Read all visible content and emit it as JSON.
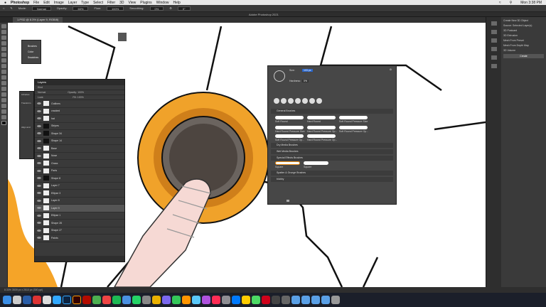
{
  "menubar": {
    "apple": "",
    "app": "Photoshop",
    "items": [
      "File",
      "Edit",
      "Image",
      "Layer",
      "Type",
      "Select",
      "Filter",
      "3D",
      "View",
      "Plugins",
      "Window",
      "Help"
    ],
    "clock": "Mon 3:38 PM"
  },
  "options": {
    "mode_label": "Mode:",
    "mode_value": "Normal",
    "opacity_label": "Opacity:",
    "opacity_value": "60%",
    "flow_label": "Flow:",
    "flow_value": "100%",
    "smoothing_label": "Smoothing:",
    "smoothing_value": "0%",
    "angle_value": "0°"
  },
  "window": {
    "title": "Adobe Photoshop 2021"
  },
  "tab": {
    "label": "1.PSD @ 8.3% (Layer 9, RGB/8)"
  },
  "brush_float": {
    "items": [
      "Brushes",
      "Color",
      "Swatches"
    ]
  },
  "layers": {
    "title": "Layers",
    "kind": "Kind",
    "blend": "Normal",
    "opacity": "Opacity: 100%",
    "lock": "Lock:",
    "fill": "Fill: 100%",
    "rows": [
      {
        "name": "Outlines"
      },
      {
        "name": "cracked"
      },
      {
        "name": "hat"
      },
      {
        "name": "Stripes"
      },
      {
        "name": "Shape 34"
      },
      {
        "name": "Shape 14"
      },
      {
        "name": "Base"
      },
      {
        "name": "Nose"
      },
      {
        "name": "Grass"
      },
      {
        "name": "Parts"
      },
      {
        "name": "Shape 8"
      },
      {
        "name": "Layer 7"
      },
      {
        "name": "Ellipse 3"
      },
      {
        "name": "Layer 8"
      },
      {
        "name": "Layer 9"
      },
      {
        "name": "Ellipse 1"
      },
      {
        "name": "Shape 28"
      },
      {
        "name": "Shape 27"
      },
      {
        "name": "Paints"
      }
    ],
    "selected_index": 14
  },
  "side_panel": {
    "items": [
      "Libraries",
      "Transform",
      "Align and"
    ]
  },
  "brush_settings": {
    "size_label": "Size:",
    "size_value": "103 px",
    "hardness_label": "Hardness:",
    "hardness_value": "0%",
    "groups": [
      "General Brushes",
      "Dry Media Brushes",
      "Wet Media Brushes",
      "Special Effects Brushes",
      "Spatter & Grunge Brushes",
      "blobby"
    ],
    "general_tips": [
      "Soft Round",
      "Hard Round",
      "Soft Round Pressure Size",
      "Hard Round Pressure Size",
      "Hard Round Pressure Op...",
      "Soft Round Pressure Op...",
      "Soft Round Pressure Op...",
      "Hard Round Pressure Op..."
    ],
    "special_tips": [
      "Square",
      "Square"
    ]
  },
  "properties": {
    "title": "Create New 3D Object",
    "source_label": "Source:",
    "source_value": "Selected Layer(s)",
    "options": [
      "3D Postcard",
      "3D Extrusion",
      "Mesh From Preset",
      "Mesh From Depth Map",
      "3D Volume"
    ],
    "create": "Create"
  },
  "status": {
    "text": "8.33%   3539 px x 2510 px (300 ppi)"
  },
  "colors": {
    "orange": "#f5a428",
    "ring": "#e88a12",
    "dark": "#4d4540",
    "skin": "#f6d9d4"
  }
}
